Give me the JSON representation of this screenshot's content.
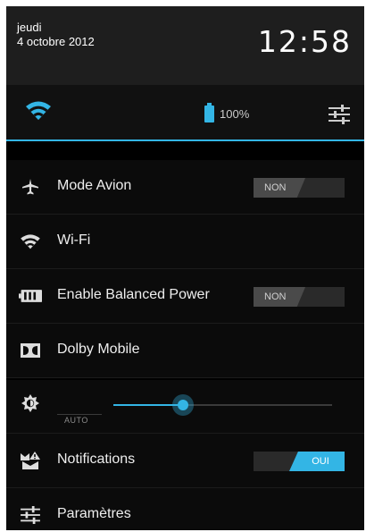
{
  "header": {
    "day": "jeudi",
    "date": "4 octobre 2012",
    "time": "12:58"
  },
  "status": {
    "wifi_icon": "wifi-icon",
    "battery_icon": "battery-icon",
    "battery_percent": "100%",
    "settings_icon": "sliders-icon"
  },
  "items": {
    "airplane": {
      "label": "Mode Avion",
      "toggle": "NON",
      "icon": "airplane-icon"
    },
    "wifi": {
      "label": "Wi-Fi",
      "icon": "wifi-icon"
    },
    "balanced_power": {
      "label": "Enable Balanced Power",
      "toggle": "NON",
      "icon": "battery-horizontal-icon"
    },
    "dolby": {
      "label": "Dolby Mobile",
      "icon": "dolby-icon"
    },
    "brightness": {
      "auto_label": "AUTO",
      "icon": "brightness-icon",
      "level": 0.32
    },
    "notifications": {
      "label": "Notifications",
      "toggle": "OUI",
      "icon": "notifications-icon"
    },
    "settings": {
      "label": "Paramètres",
      "icon": "sliders-icon"
    }
  },
  "colors": {
    "accent": "#33b5e5",
    "background": "#000000"
  }
}
